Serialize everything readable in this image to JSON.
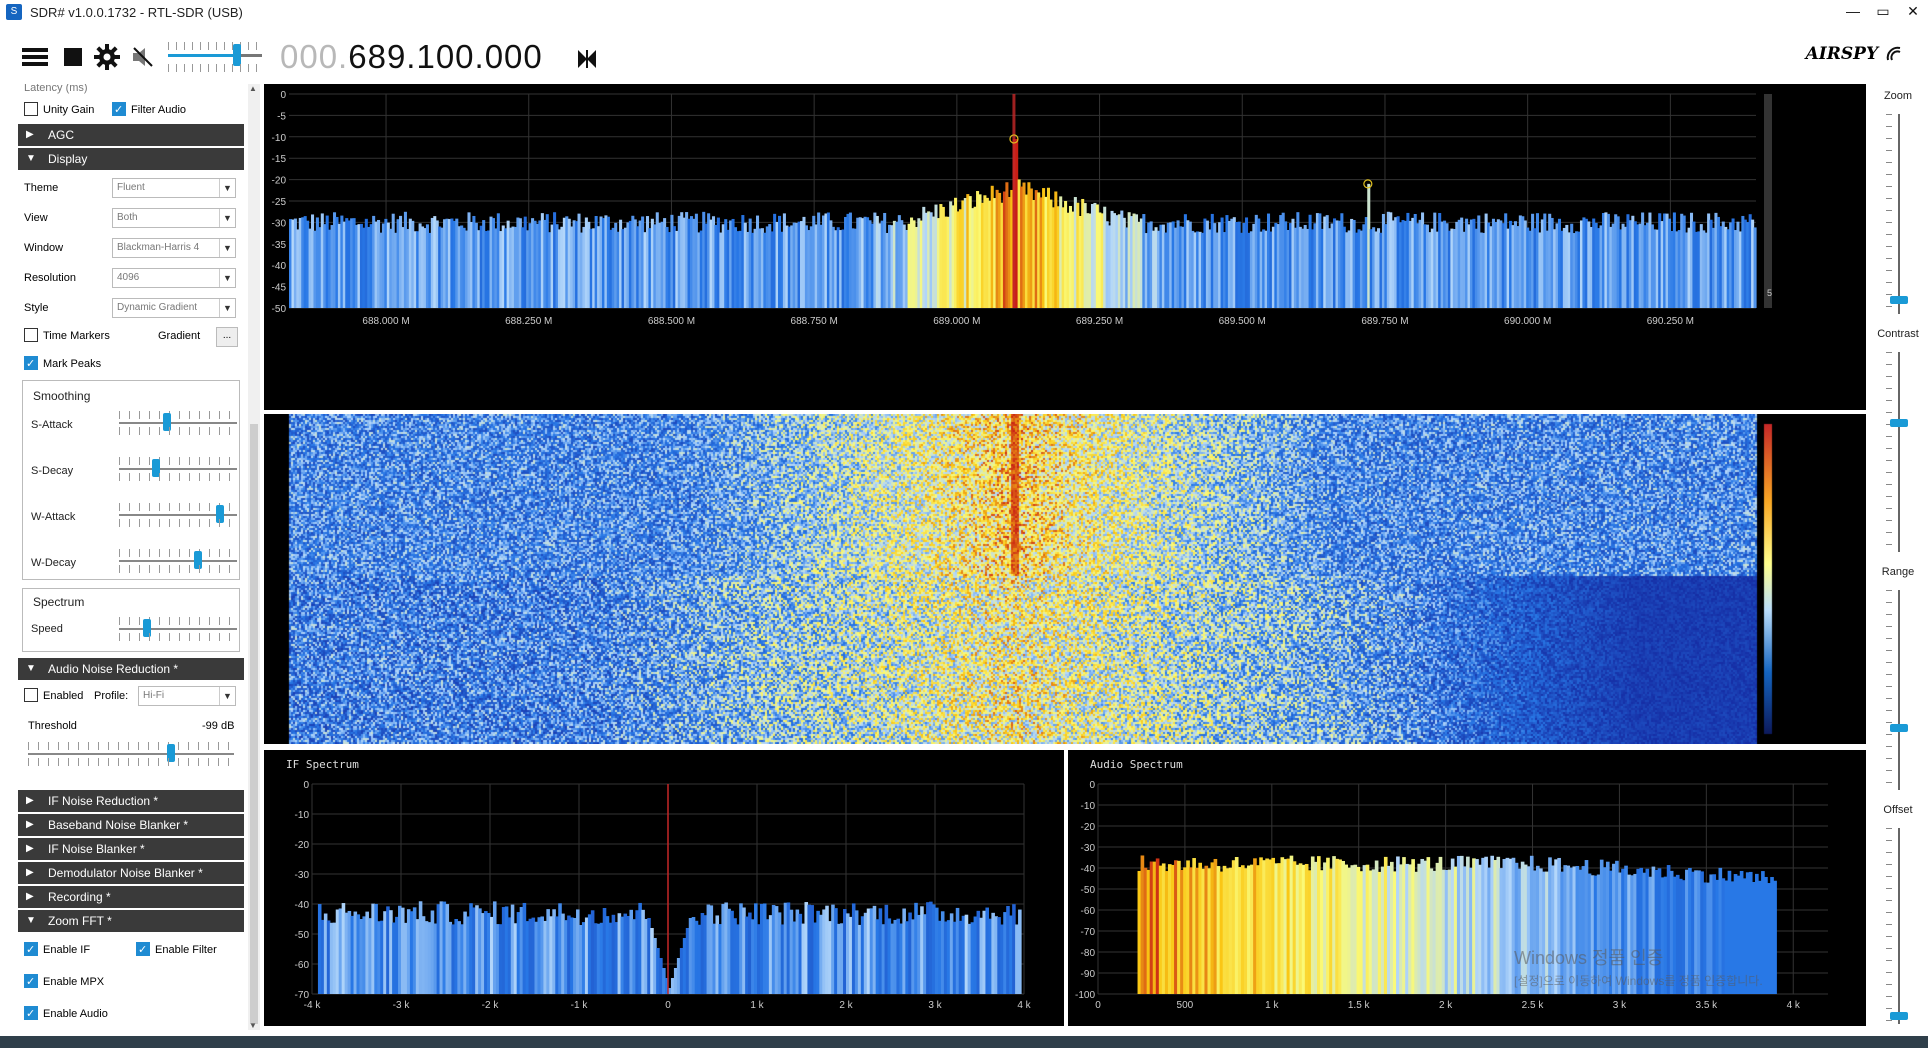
{
  "window": {
    "title": "SDR# v1.0.0.1732 - RTL-SDR (USB)",
    "minimize": "—",
    "restore": "▭",
    "close": "✕"
  },
  "toolbar": {
    "menu_icon": "hamburger-icon",
    "stop_icon": "stop-icon",
    "settings_icon": "gear-icon",
    "mute_icon": "speaker-muted-icon",
    "volume": 0.75,
    "frequency_dim": "000.",
    "frequency": "689.100.000",
    "tune_icon": "step-tune-icon",
    "brand": "AIRSPY"
  },
  "left": {
    "latency_label": "Latency (ms)",
    "unity_gain": {
      "label": "Unity Gain",
      "checked": false
    },
    "filter_audio": {
      "label": "Filter Audio",
      "checked": true
    },
    "agc": "AGC",
    "display": "Display",
    "theme": {
      "label": "Theme",
      "value": "Fluent"
    },
    "view": {
      "label": "View",
      "value": "Both"
    },
    "window": {
      "label": "Window",
      "value": "Blackman-Harris 4"
    },
    "resolution": {
      "label": "Resolution",
      "value": "4096"
    },
    "style": {
      "label": "Style",
      "value": "Dynamic Gradient"
    },
    "time_markers": {
      "label": "Time Markers",
      "checked": false
    },
    "gradient": {
      "label": "Gradient",
      "button": "..."
    },
    "mark_peaks": {
      "label": "Mark Peaks",
      "checked": true
    },
    "smoothing": {
      "title": "Smoothing",
      "s_attack": {
        "label": "S-Attack",
        "value": 0.4
      },
      "s_decay": {
        "label": "S-Decay",
        "value": 0.3
      },
      "w_attack": {
        "label": "W-Attack",
        "value": 0.88
      },
      "w_decay": {
        "label": "W-Decay",
        "value": 0.68
      }
    },
    "spectrum": {
      "title": "Spectrum",
      "speed": {
        "label": "Speed",
        "value": 0.22
      }
    },
    "audio_nr": "Audio Noise Reduction *",
    "anr_enabled": {
      "label": "Enabled",
      "checked": false
    },
    "anr_profile": {
      "label": "Profile:",
      "value": "Hi-Fi"
    },
    "threshold": {
      "label": "Threshold",
      "value": "-99 dB",
      "level": 0.7
    },
    "if_nr": "IF Noise Reduction *",
    "bb_nb": "Baseband Noise Blanker *",
    "if_nb": "IF Noise Blanker *",
    "demod_nb": "Demodulator Noise Blanker *",
    "recording": "Recording *",
    "zoom_fft": "Zoom FFT *",
    "enable_if": {
      "label": "Enable IF",
      "checked": true
    },
    "enable_filter": {
      "label": "Enable Filter",
      "checked": true
    },
    "enable_mpx": {
      "label": "Enable MPX",
      "checked": true
    },
    "enable_audio": {
      "label": "Enable Audio",
      "checked": true
    }
  },
  "right": {
    "zoom": "Zoom",
    "contrast": "Contrast",
    "range": "Range",
    "offset": "Offset",
    "zoom_level": 0.05,
    "contrast_level": 0.65,
    "range_level": 0.3,
    "offset_level": 0.02,
    "range_readout": "5"
  },
  "chart_data": [
    {
      "type": "area",
      "name": "main-spectrum",
      "y_ticks": [
        "0",
        "-5",
        "-10",
        "-15",
        "-20",
        "-25",
        "-30",
        "-35",
        "-40",
        "-45",
        "-50"
      ],
      "x_ticks": [
        "688.000 M",
        "688.250 M",
        "688.500 M",
        "688.750 M",
        "689.000 M",
        "689.250 M",
        "689.500 M",
        "689.750 M",
        "690.000 M",
        "690.250 M"
      ],
      "ylim": [
        -50,
        0
      ],
      "xlim_mhz": [
        687.83,
        690.4
      ],
      "peaks_mhz": [
        689.1,
        689.72
      ],
      "peak_dbs": [
        -10.5,
        -21
      ],
      "noise_floor_db": -30,
      "tuned_mhz": 689.1
    },
    {
      "type": "area",
      "name": "if-spectrum",
      "title": "IF Spectrum",
      "y_ticks": [
        "0",
        "-10",
        "-20",
        "-30",
        "-40",
        "-50",
        "-60",
        "-70"
      ],
      "x_ticks": [
        "-4 k",
        "-3 k",
        "-2 k",
        "-1 k",
        "0",
        "1 k",
        "2 k",
        "3 k",
        "4 k"
      ],
      "ylim": [
        -70,
        0
      ],
      "xlim_khz": [
        -4,
        4
      ],
      "level_db": -43
    },
    {
      "type": "area",
      "name": "audio-spectrum",
      "title": "Audio Spectrum",
      "y_ticks": [
        "0",
        "-10",
        "-20",
        "-30",
        "-40",
        "-50",
        "-60",
        "-70",
        "-80",
        "-90",
        "-100"
      ],
      "x_ticks": [
        "0",
        "500",
        "1 k",
        "1.5 k",
        "2 k",
        "2.5 k",
        "3 k",
        "3.5 k",
        "4 k"
      ],
      "ylim": [
        -100,
        0
      ],
      "xlim_hz": [
        0,
        4200
      ],
      "level_db": -38
    }
  ],
  "watermark": {
    "line1": "Windows 정품 인증",
    "line2": "[설정]으로 이동하여 Windows를 정품 인증합니다."
  }
}
